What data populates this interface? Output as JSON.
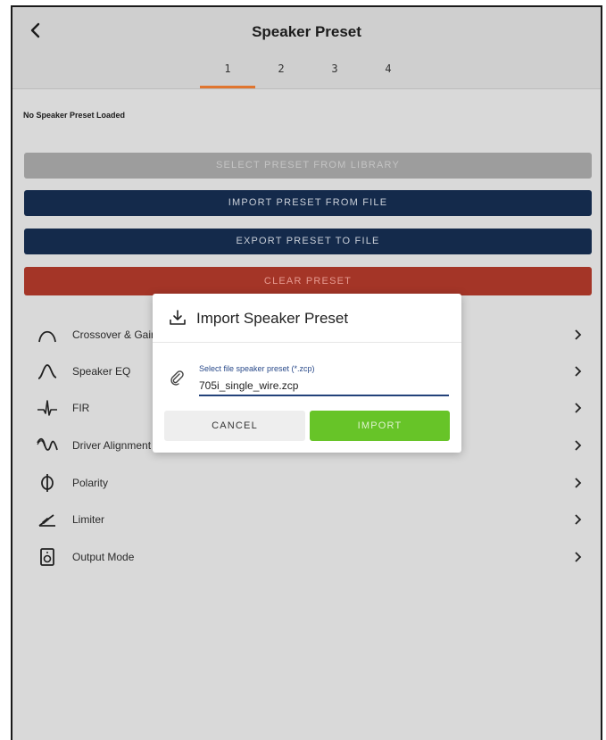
{
  "header": {
    "title": "Speaker Preset",
    "back_icon": "chevron-left-icon",
    "tabs": [
      "1",
      "2",
      "3",
      "4"
    ],
    "active_tab": "1",
    "accent_color": "#e0752f"
  },
  "status": {
    "text": "No Speaker Preset Loaded"
  },
  "actions": {
    "library": "SELECT PRESET FROM LIBRARY",
    "import": "IMPORT PRESET FROM FILE",
    "export": "EXPORT PRESET TO FILE",
    "clear": "CLEAR PRESET"
  },
  "menu": [
    {
      "label": "Crossover & Gain",
      "icon": "crossover-icon"
    },
    {
      "label": "Speaker EQ",
      "icon": "eq-curve-icon"
    },
    {
      "label": "FIR",
      "icon": "fir-icon"
    },
    {
      "label": "Driver Alignment",
      "icon": "driver-alignment-icon"
    },
    {
      "label": "Polarity",
      "icon": "polarity-icon"
    },
    {
      "label": "Limiter",
      "icon": "limiter-icon"
    },
    {
      "label": "Output Mode",
      "icon": "output-mode-icon"
    }
  ],
  "dialog": {
    "title": "Import Speaker Preset",
    "field_label": "Select file speaker preset (*.zcp)",
    "field_value": "705i_single_wire.zcp",
    "cancel": "CANCEL",
    "import": "IMPORT"
  }
}
